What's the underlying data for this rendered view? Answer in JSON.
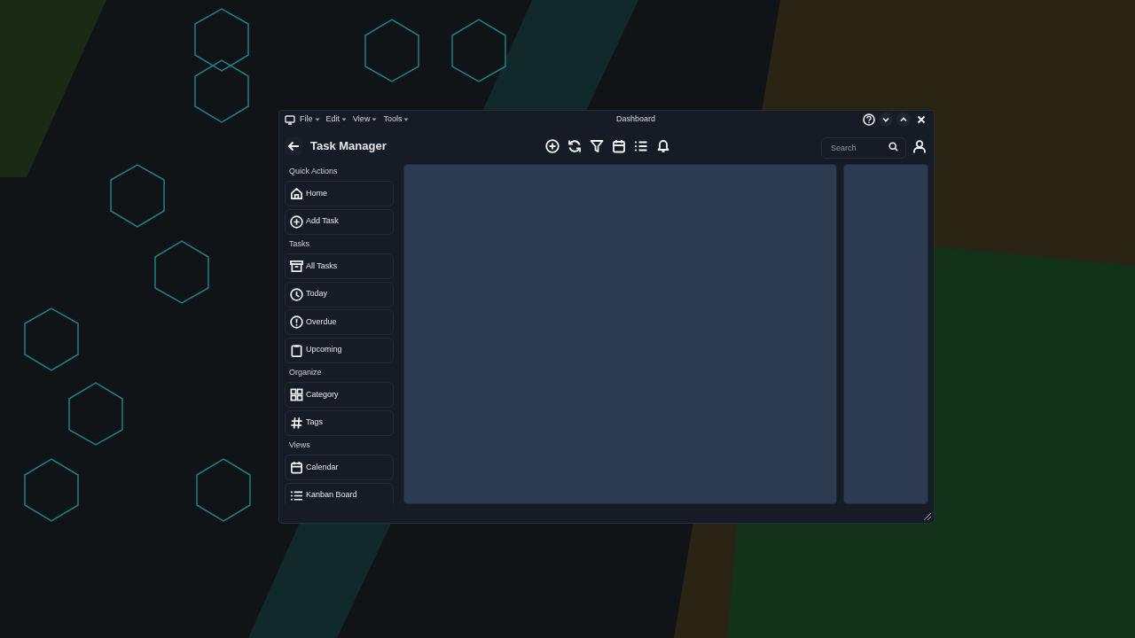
{
  "window": {
    "title": "Dashboard",
    "menus": [
      "File",
      "Edit",
      "View",
      "Tools"
    ]
  },
  "header": {
    "title": "Task Manager",
    "search": {
      "placeholder": "Search"
    }
  },
  "sidebar": {
    "sections": [
      {
        "label": "Quick Actions",
        "items": [
          "Home",
          "Add Task"
        ]
      },
      {
        "label": "Tasks",
        "items": [
          "All Tasks",
          "Today",
          "Overdue",
          "Upcoming"
        ]
      },
      {
        "label": "Organize",
        "items": [
          "Category",
          "Tags"
        ]
      },
      {
        "label": "Views",
        "items": [
          "Calendar",
          "Kanban Board"
        ]
      }
    ]
  }
}
